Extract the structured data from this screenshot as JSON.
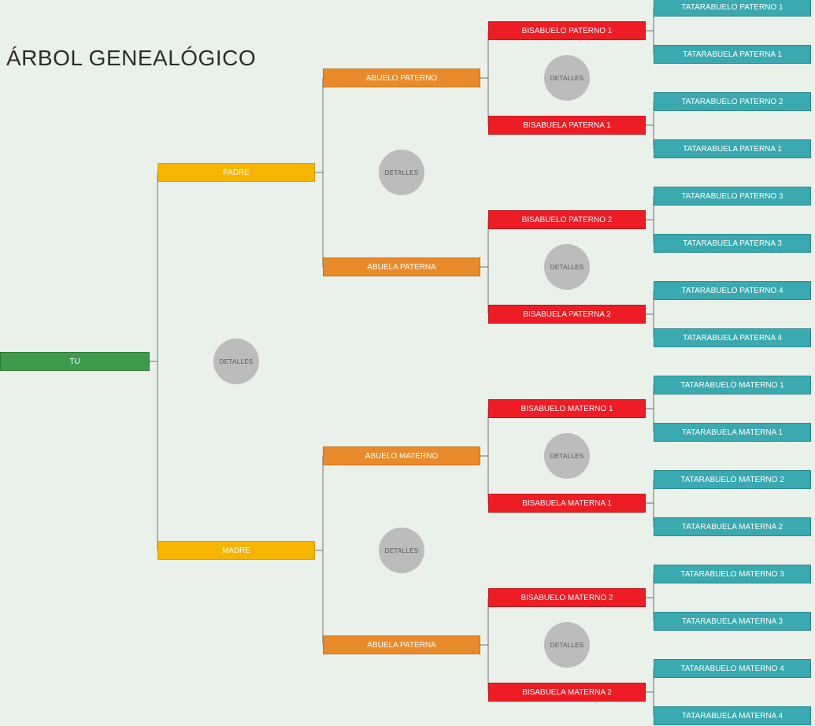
{
  "title": "ÁRBOL GENEALÓGICO",
  "details_label": "DETALLES",
  "gen0": {
    "you": "TU"
  },
  "gen1": {
    "father": "PADRE",
    "mother": "MADRE"
  },
  "gen2": {
    "pgf": "ABUELO PATERNO",
    "pgm": "ABUELA PATERNA",
    "mgf": "ABUELO MATERNO",
    "mgm": "ABUELA PATERNA"
  },
  "gen3": {
    "p1": "BISABUELO PATERNO 1",
    "p2": "BISABUELA PATERNA 1",
    "p3": "BISABUELO PATERNO 2",
    "p4": "BISABUELA PATERNA 2",
    "m1": "BISABUELO MATERNO 1",
    "m2": "BISABUELA MATERNA 1",
    "m3": "BISABUELO MATERNO 2",
    "m4": "BISABUELA MATERNA 2"
  },
  "gen4": {
    "t1": "TATARABUELO PATERNO 1",
    "t2": "TATARABUELA PATERNA 1",
    "t3": "TATARABUELO PATERNO 2",
    "t4": "TATARABUELA PATERNA 1",
    "t5": "TATARABUELO PATERNO 3",
    "t6": "TATARABUELA PATERNA 3",
    "t7": "TATARABUELO PATERNO 4",
    "t8": "TATARABUELA PATERNA 4",
    "t9": "TATARABUELO MATERNO 1",
    "t10": "TATARABUELA MATERNA 1",
    "t11": "TATARABUELO MATERNO 2",
    "t12": "TATARABUELA MATERNA 2",
    "t13": "TATARABUELO MATERNO 3",
    "t14": "TATARABUELA MATERNA 3",
    "t15": "TATARABUELO MATERNO 4",
    "t16": "TATARABUELA MATERNA 4"
  },
  "colors": {
    "gen0": "#3e9a4c",
    "gen1": "#f7b500",
    "gen2": "#e98b2a",
    "gen3": "#ee1c25",
    "gen4": "#3aa9b0"
  }
}
